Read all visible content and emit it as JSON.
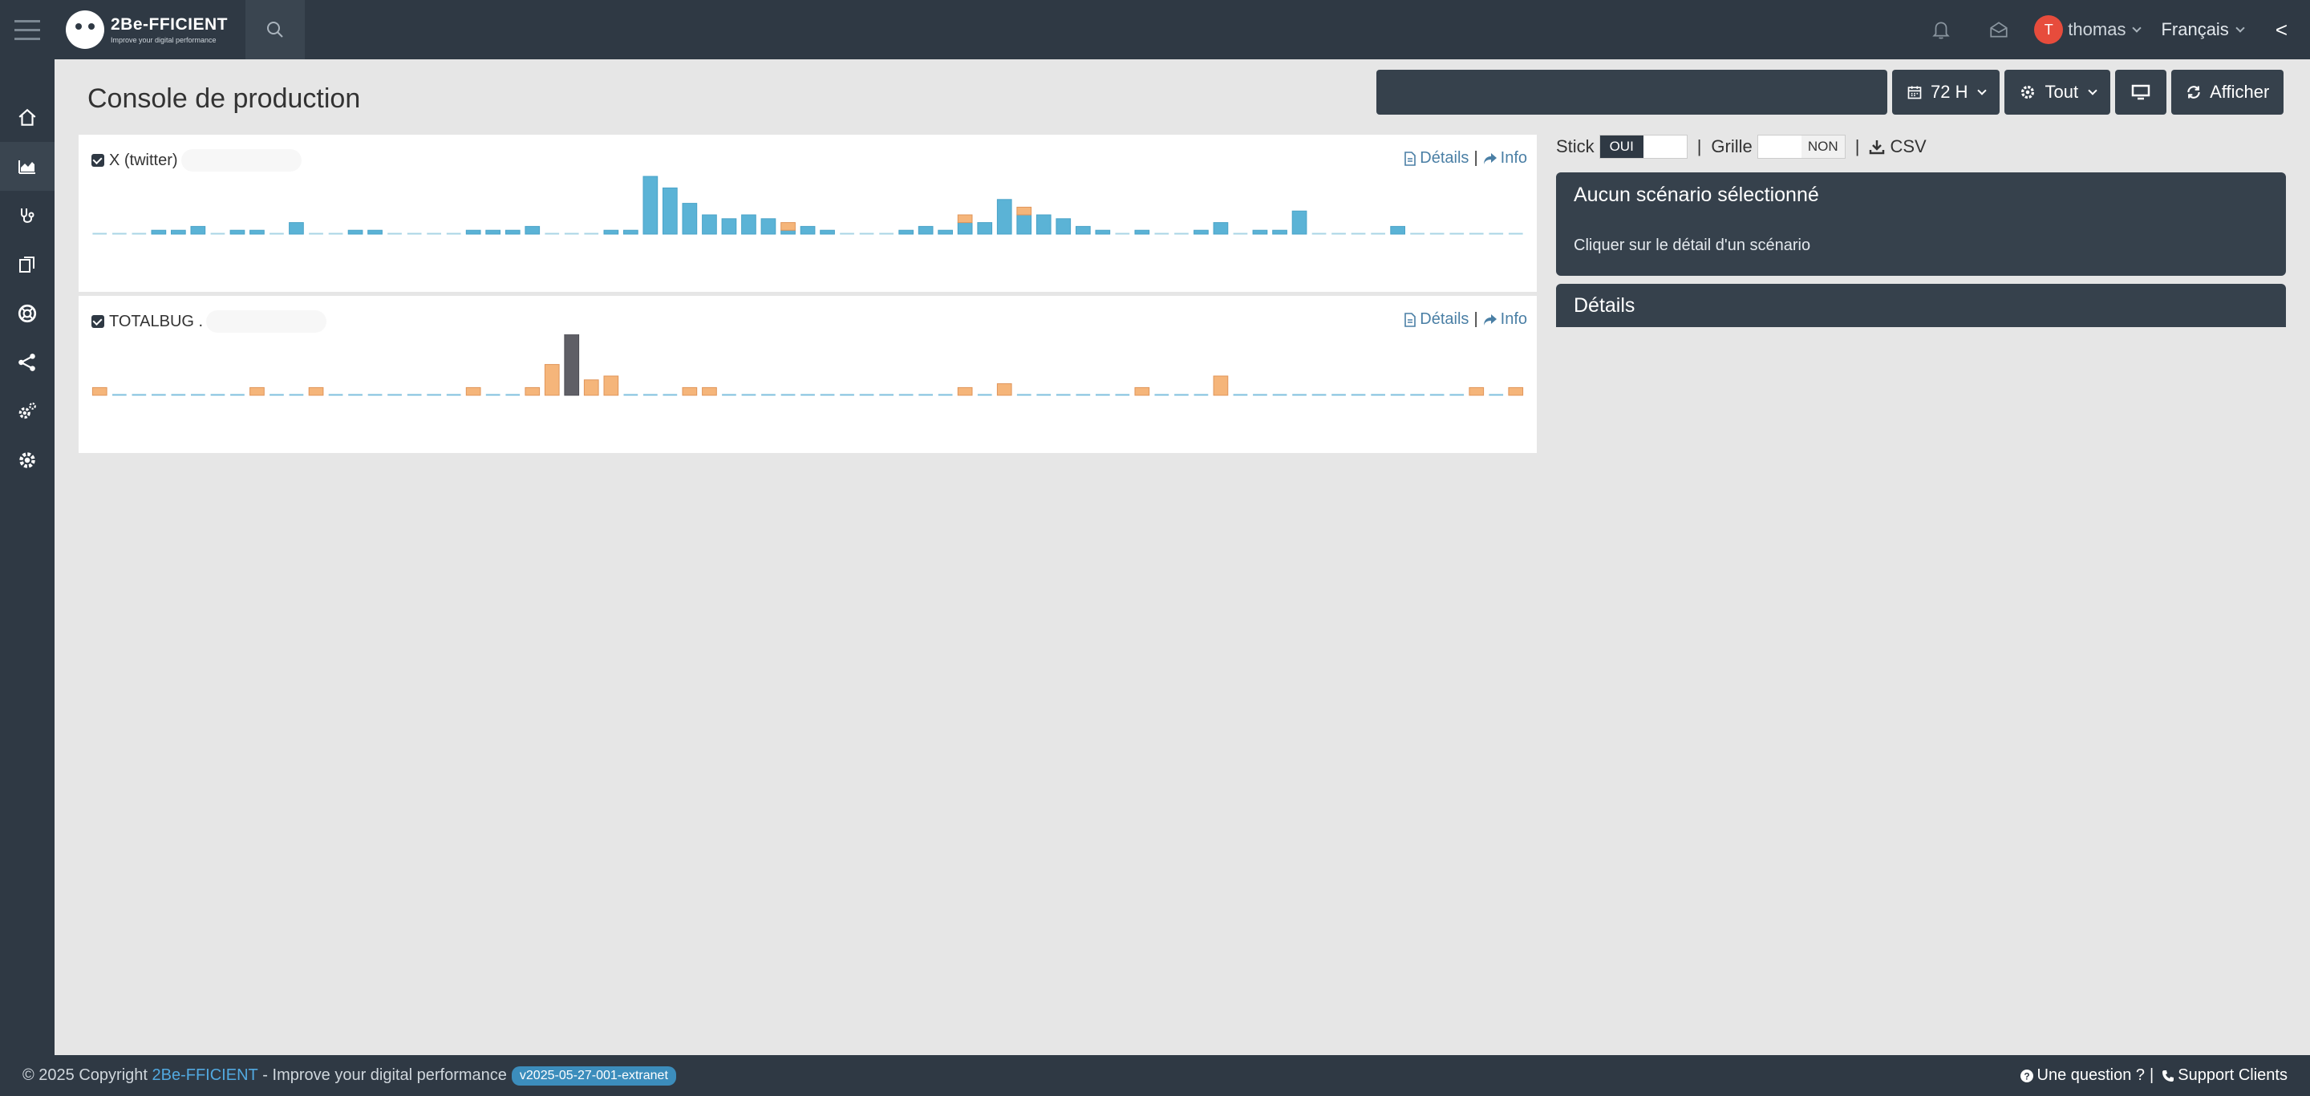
{
  "header": {
    "logo_name": "2Be-FFICIENT",
    "logo_tagline": "Improve your digital performance",
    "user_initial": "T",
    "user_name": "thomas",
    "language": "Français",
    "collapse_label": "<"
  },
  "sidebar": {
    "items": [
      {
        "icon": "home-icon"
      },
      {
        "icon": "area-chart-icon",
        "active": true
      },
      {
        "icon": "stethoscope-icon"
      },
      {
        "icon": "documents-icon"
      },
      {
        "icon": "lifebuoy-icon"
      },
      {
        "icon": "share-icon"
      },
      {
        "icon": "cogs-icon"
      },
      {
        "icon": "gear-icon"
      }
    ]
  },
  "main": {
    "title": "Console de production",
    "search_value": "",
    "period_label": "72 H",
    "filter_label": "Tout",
    "show_label": "Afficher"
  },
  "panels": [
    {
      "title": "X (twitter)",
      "details_label": "Détails",
      "info_label": "Info"
    },
    {
      "title": "TOTALBUG .",
      "details_label": "Détails",
      "info_label": "Info"
    }
  ],
  "options": {
    "stick_label": "Stick",
    "stick_on": "OUI",
    "separator": "|",
    "grid_label": "Grille",
    "grid_off": "NON",
    "csv_label": "CSV"
  },
  "scenario": {
    "title": "Aucun scénario sélectionné",
    "hint": "Cliquer sur le détail d'un scénario"
  },
  "details": {
    "title": "Détails"
  },
  "footer": {
    "copyright_prefix": "© 2025 Copyright ",
    "brand": "2Be-FFICIENT",
    "tagline": " - Improve your digital performance",
    "version": "v2025-05-27-001-extranet",
    "question": "Une question ?",
    "separator": "|",
    "support": "Support Clients"
  },
  "colors": {
    "nav": "#2f3944",
    "ok": "#5bb3d6",
    "warning": "#f5b57a",
    "critical": "#5f5f66"
  },
  "chart_data": [
    {
      "type": "bar",
      "title": "X (twitter)",
      "x_count": 73,
      "series": [
        {
          "status": "ok",
          "values": [
            0,
            0,
            0,
            1,
            1,
            2,
            0,
            1,
            1,
            0,
            3,
            0,
            0,
            1,
            1,
            0,
            0,
            0,
            0,
            1,
            1,
            1,
            2,
            0,
            0,
            0,
            1,
            1,
            15,
            12,
            8,
            5,
            4,
            5,
            4,
            1,
            2,
            1,
            0,
            0,
            0,
            1,
            2,
            1,
            3,
            3,
            9,
            5,
            5,
            4,
            2,
            1,
            0,
            1,
            0,
            0,
            1,
            3,
            0,
            1,
            1,
            6,
            0,
            0,
            0,
            0,
            2,
            0,
            0,
            0,
            0,
            0,
            0
          ]
        },
        {
          "status": "warning",
          "values": [
            0,
            0,
            0,
            0,
            0,
            0,
            0,
            0,
            0,
            0,
            0,
            0,
            0,
            0,
            0,
            0,
            0,
            0,
            0,
            0,
            0,
            0,
            0,
            0,
            0,
            0,
            0,
            0,
            0,
            0,
            0,
            0,
            0,
            0,
            0,
            2,
            0,
            0,
            0,
            0,
            0,
            0,
            0,
            0,
            2,
            0,
            0,
            2,
            0,
            0,
            0,
            0,
            0,
            0,
            0,
            0,
            0,
            0,
            0,
            0,
            0,
            0,
            0,
            0,
            0,
            0,
            0,
            0,
            0,
            0,
            0,
            0,
            0
          ]
        }
      ]
    },
    {
      "type": "bar",
      "title": "TOTALBUG .",
      "x_count": 73,
      "series": [
        {
          "status": "warning",
          "values": [
            2,
            0,
            0,
            0,
            0,
            0,
            0,
            0,
            2,
            0,
            0,
            2,
            0,
            0,
            0,
            0,
            0,
            0,
            0,
            2,
            0,
            0,
            2,
            8,
            0,
            4,
            5,
            0,
            0,
            0,
            2,
            2,
            0,
            0,
            0,
            0,
            0,
            0,
            0,
            0,
            0,
            0,
            0,
            0,
            2,
            0,
            3,
            0,
            0,
            0,
            0,
            0,
            0,
            2,
            0,
            0,
            0,
            5,
            0,
            0,
            0,
            0,
            0,
            0,
            0,
            0,
            0,
            0,
            0,
            0,
            2,
            0,
            2
          ]
        },
        {
          "status": "critical",
          "values": [
            0,
            0,
            0,
            0,
            0,
            0,
            0,
            0,
            0,
            0,
            0,
            0,
            0,
            0,
            0,
            0,
            0,
            0,
            0,
            0,
            0,
            0,
            0,
            0,
            17,
            0,
            0,
            0,
            0,
            0,
            0,
            0,
            0,
            0,
            0,
            0,
            0,
            0,
            0,
            0,
            0,
            0,
            0,
            0,
            0,
            0,
            0,
            0,
            0,
            0,
            0,
            0,
            0,
            0,
            0,
            0,
            0,
            0,
            0,
            0,
            0,
            0,
            0,
            0,
            0,
            0,
            0,
            0,
            0,
            0,
            0,
            0,
            0
          ]
        }
      ]
    }
  ]
}
